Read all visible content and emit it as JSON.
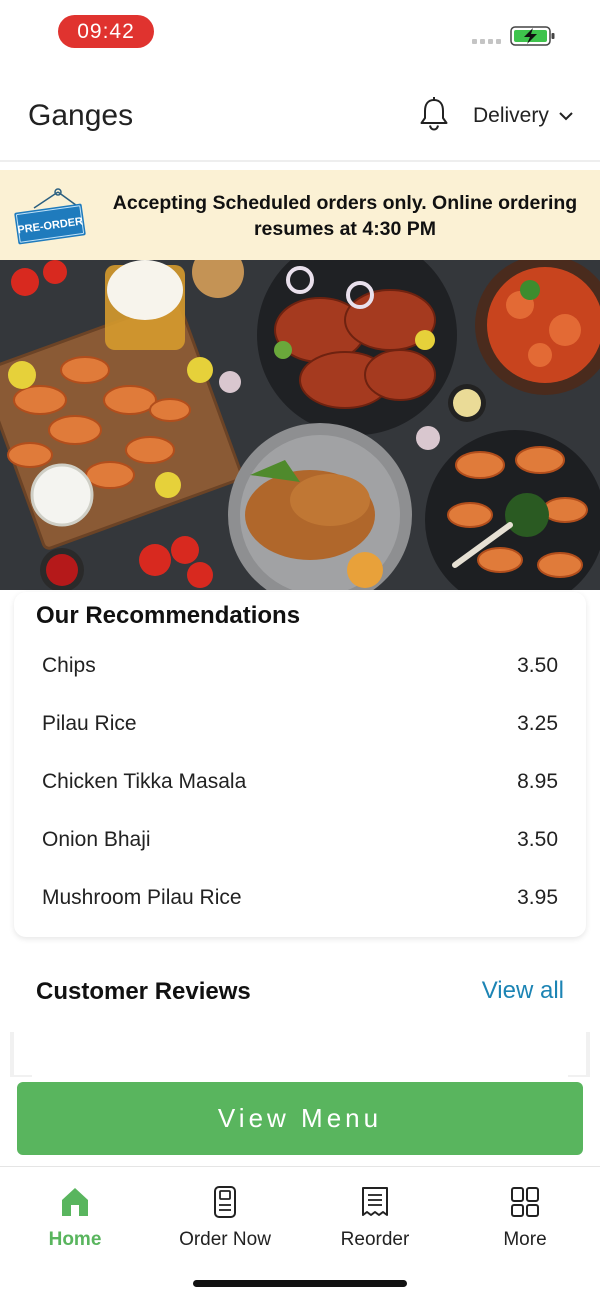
{
  "status_bar": {
    "time": "09:42"
  },
  "header": {
    "title": "Ganges",
    "delivery_label": "Delivery"
  },
  "banner": {
    "tag": "PRE-ORDER",
    "message": "Accepting Scheduled orders only. Online ordering resumes at 4:30 PM"
  },
  "recommendations": {
    "title": "Our Recommendations",
    "items": [
      {
        "name": "Chips",
        "price": "3.50"
      },
      {
        "name": "Pilau Rice",
        "price": "3.25"
      },
      {
        "name": "Chicken Tikka Masala",
        "price": "8.95"
      },
      {
        "name": "Onion Bhaji",
        "price": "3.50"
      },
      {
        "name": "Mushroom Pilau Rice",
        "price": "3.95"
      }
    ]
  },
  "reviews": {
    "title": "Customer Reviews",
    "view_all": "View all"
  },
  "cta": {
    "label": "View Menu"
  },
  "tabs": [
    {
      "label": "Home",
      "icon": "home-icon",
      "active": true
    },
    {
      "label": "Order Now",
      "icon": "phone-order-icon",
      "active": false
    },
    {
      "label": "Reorder",
      "icon": "receipt-icon",
      "active": false
    },
    {
      "label": "More",
      "icon": "grid-icon",
      "active": false
    }
  ],
  "colors": {
    "accent_green": "#59b55e",
    "link_blue": "#1c84b4",
    "banner_bg": "#fbf1d4",
    "time_pill": "#e0332f"
  }
}
